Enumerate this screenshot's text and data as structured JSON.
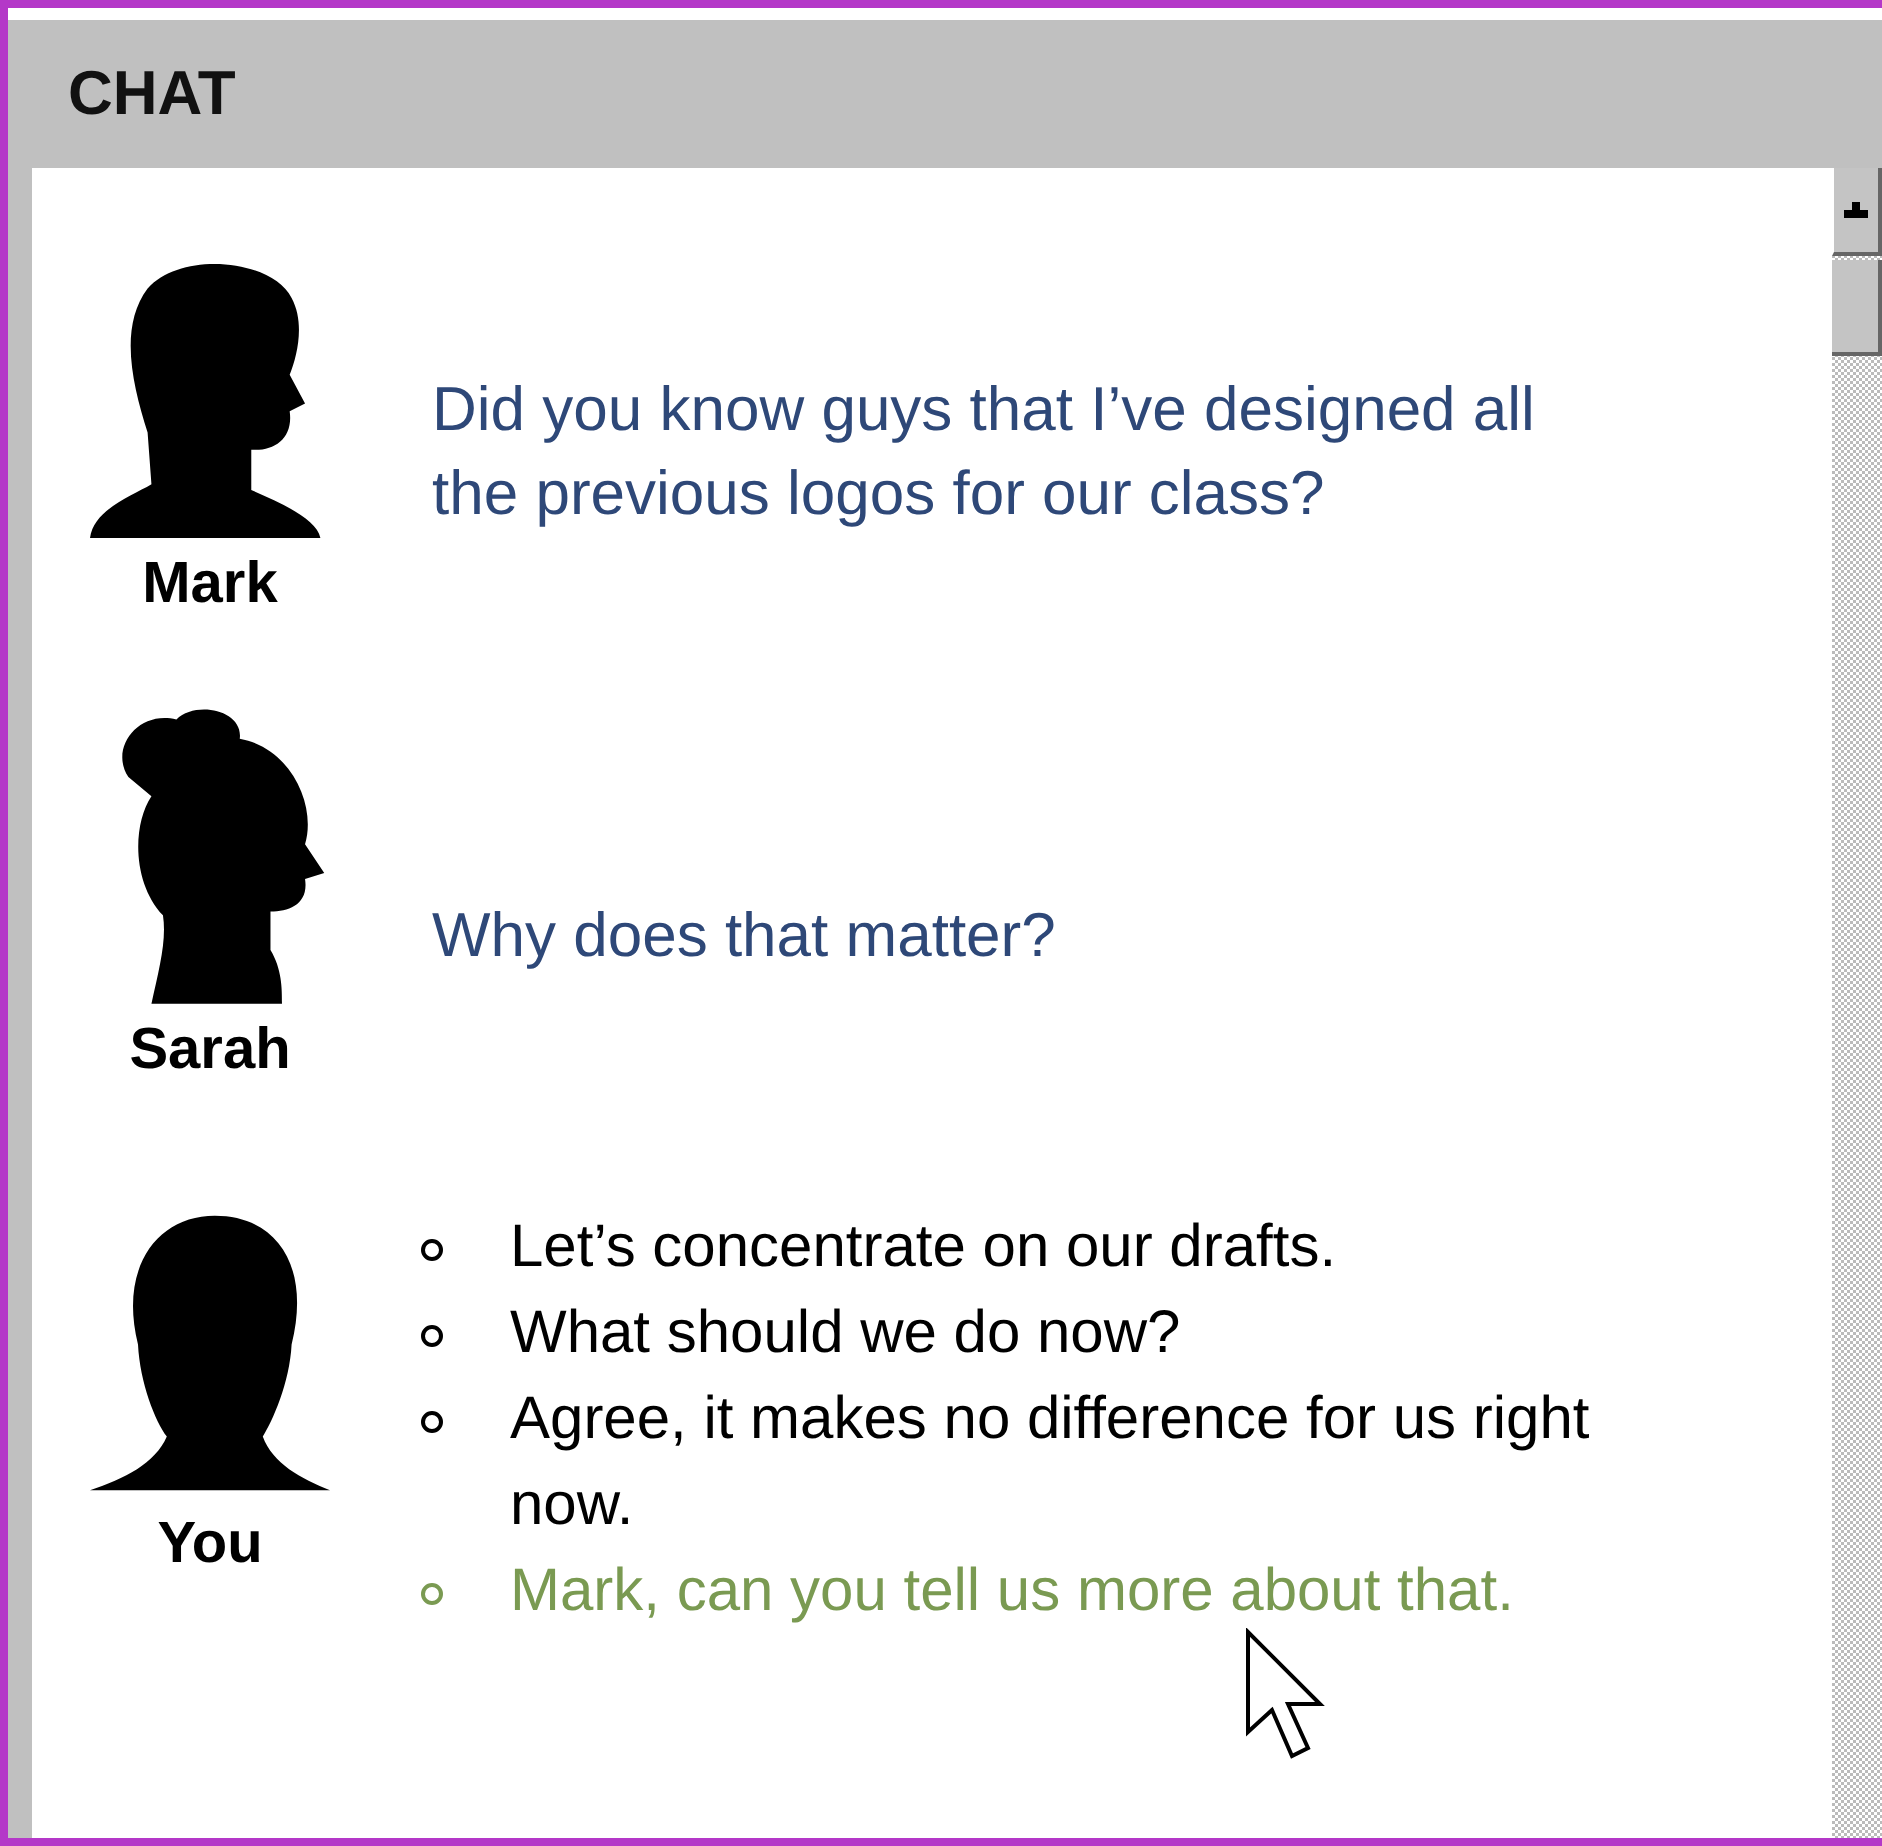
{
  "panel": {
    "title": "CHAT"
  },
  "messages": [
    {
      "kind": "text",
      "sender": "Mark",
      "text": "Did you know guys that I’ve designed all the previous logos for our class?"
    },
    {
      "kind": "text",
      "sender": "Sarah",
      "text": "Why does that matter?"
    },
    {
      "kind": "options",
      "sender": "You",
      "options": [
        {
          "text": "Let’s concentrate on our drafts.",
          "selected": false
        },
        {
          "text": "What should we do now?",
          "selected": false
        },
        {
          "text": "Agree, it makes no difference for us right now.",
          "selected": false
        },
        {
          "text": "Mark, can you tell us more about that.",
          "selected": true
        }
      ]
    }
  ]
}
